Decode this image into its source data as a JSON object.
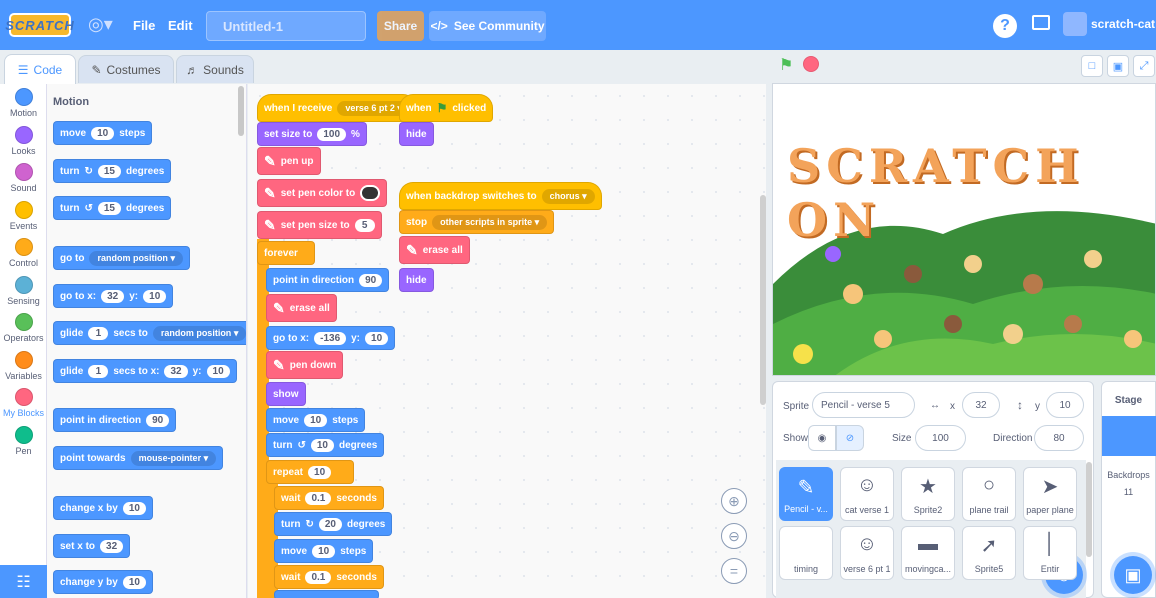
{
  "menubar": {
    "logo": "SCRATCH",
    "file": "File",
    "edit": "Edit",
    "project_title": "Untitled-1",
    "share": "Share",
    "see_community": "See Community",
    "username": "scratch-cat",
    "help": "?"
  },
  "tabs": {
    "code": "Code",
    "costumes": "Costumes",
    "sounds": "Sounds"
  },
  "categories": [
    "Motion",
    "Looks",
    "Sound",
    "Events",
    "Control",
    "Sensing",
    "Operators",
    "Variables",
    "My Blocks",
    "Pen"
  ],
  "category_colors": [
    "#4c97ff",
    "#9966ff",
    "#cf63cf",
    "#ffbf00",
    "#ffab19",
    "#5cb1d6",
    "#59c059",
    "#ff8c1a",
    "#ff6680",
    "#0fbd8c"
  ],
  "palette": {
    "heading": "Motion",
    "move": {
      "a": "move",
      "n": "10",
      "b": "steps"
    },
    "turn_right": {
      "a": "turn",
      "n": "15",
      "b": "degrees"
    },
    "turn_left": {
      "a": "turn",
      "n": "15",
      "b": "degrees"
    },
    "goto_random": {
      "a": "go to",
      "d": "random position"
    },
    "goto_xy": {
      "a": "go to x:",
      "x": "32",
      "b": "y:",
      "y": "10"
    },
    "glide_random": {
      "a": "glide",
      "n": "1",
      "b": "secs to",
      "d": "random position"
    },
    "glide_xy": {
      "a": "glide",
      "n": "1",
      "b": "secs to x:",
      "x": "32",
      "c": "y:",
      "y": "10"
    },
    "point_dir": {
      "a": "point in direction",
      "n": "90"
    },
    "point_towards": {
      "a": "point towards",
      "d": "mouse-pointer"
    },
    "change_x": {
      "a": "change x by",
      "n": "10"
    },
    "set_x": {
      "a": "set x to",
      "n": "32"
    },
    "change_y": {
      "a": "change y by",
      "n": "10"
    }
  },
  "script1": {
    "when_receive": "when I receive",
    "when_receive_dd": "verse 6 pt 2",
    "set_size": "set size to",
    "set_size_n": "100",
    "set_size_unit": "%",
    "pen_up": "pen up",
    "set_pen_color": "set pen color to",
    "set_pen_size": "set pen size to",
    "set_pen_size_n": "5",
    "forever": "forever",
    "point_dir": "point in direction",
    "point_dir_n": "90",
    "erase_all": "erase all",
    "goto": "go to x:",
    "goto_x": "-136",
    "goto_y_lbl": "y:",
    "goto_y": "10",
    "pen_down": "pen down",
    "show": "show",
    "move": "move",
    "move_n": "10",
    "move_u": "steps",
    "turn": "turn",
    "turn_n": "10",
    "turn_u": "degrees",
    "repeat": "repeat",
    "repeat_n": "10",
    "wait": "wait",
    "wait_n": "0.1",
    "wait_u": "seconds",
    "turn2_n": "20",
    "turn2_u": "degrees",
    "move2_n": "10",
    "move2_u": "steps",
    "wait2_n": "0.1",
    "wait2_u": "seconds"
  },
  "script2": {
    "when": "when",
    "clicked": "clicked",
    "hide": "hide"
  },
  "script3": {
    "when_backdrop": "when backdrop switches to",
    "when_backdrop_dd": "chorus",
    "stop": "stop",
    "stop_dd": "other scripts in sprite",
    "erase_all": "erase all",
    "hide": "hide"
  },
  "stage": {
    "title": "SCRATCH ON"
  },
  "sprite_info": {
    "sprite_lbl": "Sprite",
    "sprite_name": "Pencil - verse 5",
    "x_lbl": "x",
    "x": "32",
    "y_lbl": "y",
    "y": "10",
    "show_lbl": "Show",
    "size_lbl": "Size",
    "size": "100",
    "direction_lbl": "Direction",
    "direction": "80"
  },
  "sprites": [
    "Pencil - v...",
    "cat verse 1",
    "Sprite2",
    "plane trail",
    "paper plane",
    "timing",
    "verse 6 pt 1",
    "movingca...",
    "Sprite5",
    "Entir"
  ],
  "stage_pane": {
    "title": "Stage",
    "backdrops_lbl": "Backdrops",
    "backdrops_n": "11"
  }
}
